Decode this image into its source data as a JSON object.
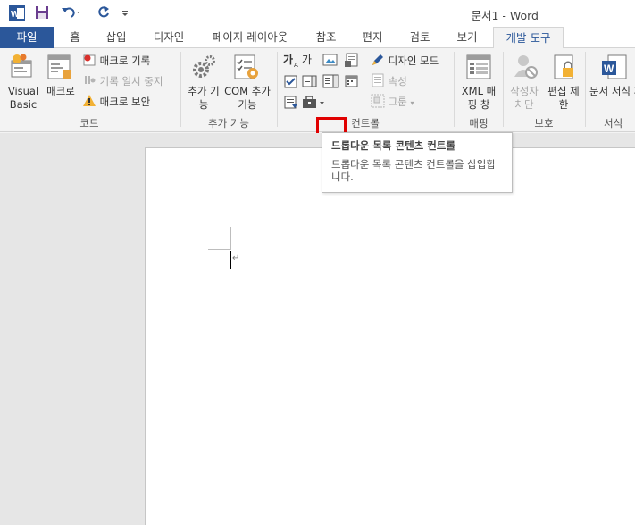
{
  "window": {
    "title": "문서1 - Word",
    "app_icon": "word-icon",
    "qat": [
      "save-icon",
      "undo-icon",
      "redo-icon",
      "customize-qat-icon"
    ]
  },
  "tabs": [
    {
      "id": "file",
      "label": "파일"
    },
    {
      "id": "home",
      "label": "홈"
    },
    {
      "id": "insert",
      "label": "삽입"
    },
    {
      "id": "design",
      "label": "디자인"
    },
    {
      "id": "layout",
      "label": "페이지 레이아웃"
    },
    {
      "id": "references",
      "label": "참조"
    },
    {
      "id": "mailings",
      "label": "편지"
    },
    {
      "id": "review",
      "label": "검토"
    },
    {
      "id": "view",
      "label": "보기"
    },
    {
      "id": "developer",
      "label": "개발 도구",
      "active": true
    }
  ],
  "groups": {
    "code": {
      "label": "코드",
      "visual_basic": "Visual Basic",
      "macros": "매크로",
      "record_macro": "매크로 기록",
      "pause_recording": "기록 일시 중지",
      "macro_security": "매크로 보안"
    },
    "addins": {
      "label": "추가 기능",
      "addins_btn": "추가 기능",
      "com_addins": "COM 추가 기능"
    },
    "controls": {
      "label": "컨트롤",
      "design_mode": "디자인 모드",
      "properties": "속성",
      "group": "그룹"
    },
    "mapping": {
      "label": "매핑",
      "xml_pane": "XML 매핑 창"
    },
    "protect": {
      "label": "보호",
      "block_authors": "작성자 차단",
      "restrict_editing": "편집 제한"
    },
    "templates": {
      "label": "서식",
      "doc_template": "문서 서식 파일"
    }
  },
  "tooltip": {
    "title": "드롭다운 목록 콘텐츠 컨트롤",
    "body": "드롭다운 목록 콘텐츠 컨트롤을 삽입합니다."
  },
  "colors": {
    "accent": "#2b579a",
    "highlight": "#e00000"
  }
}
